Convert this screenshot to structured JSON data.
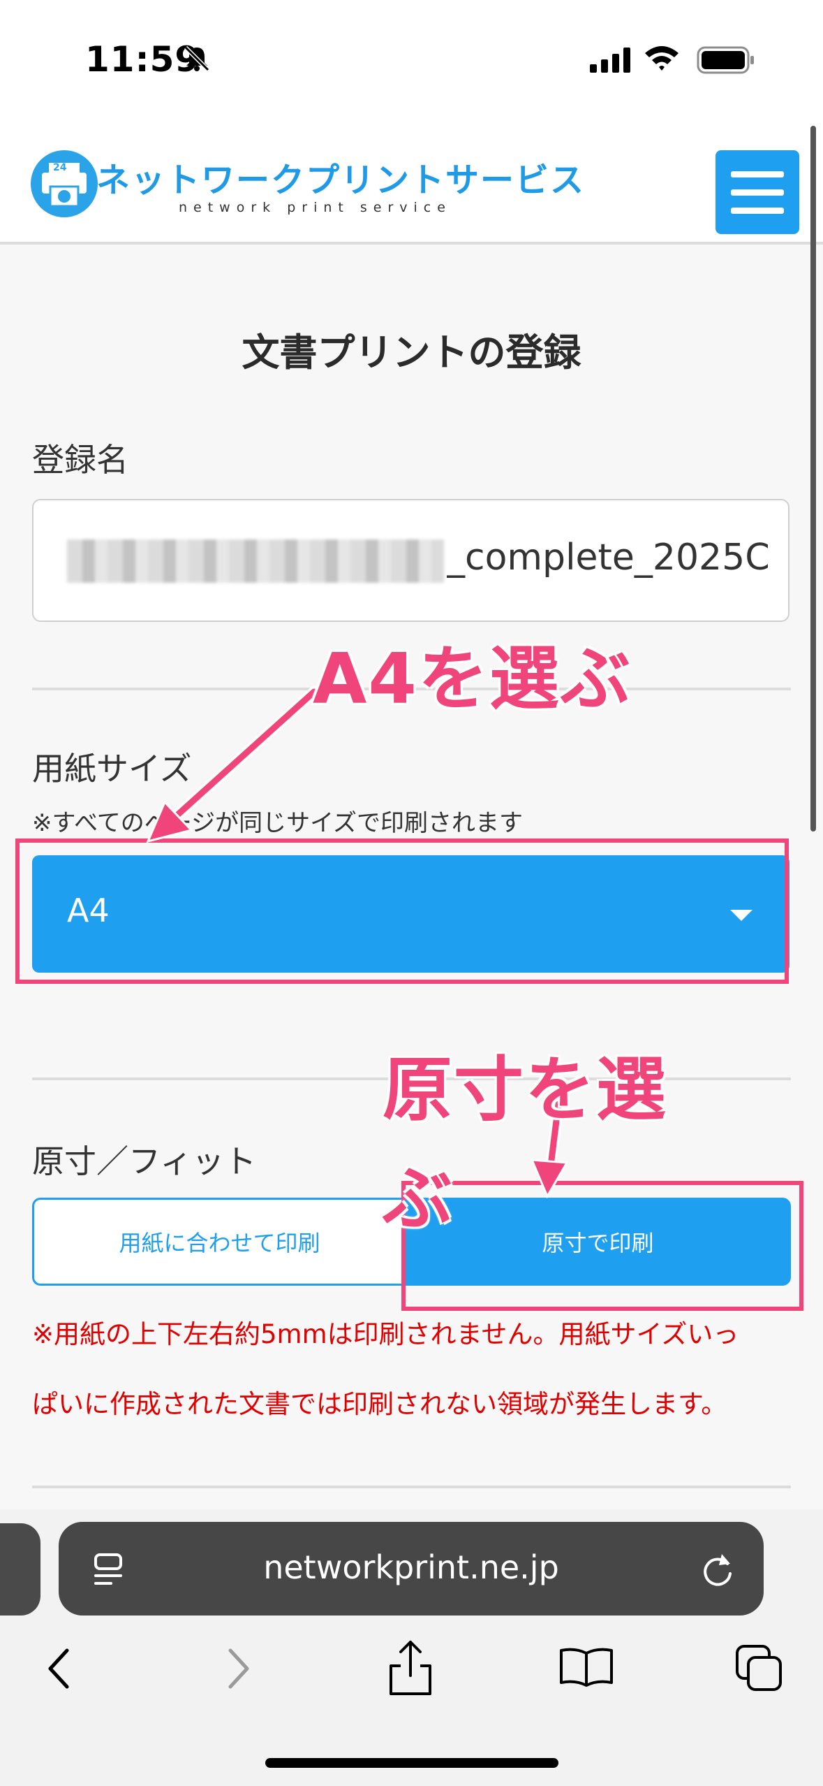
{
  "status_bar": {
    "time": "11:59"
  },
  "header": {
    "logo_title": "ネットワークプリントサービス",
    "logo_subtitle": "network print service",
    "logo_badge": "24",
    "menu_icon": "hamburger-menu-icon"
  },
  "main": {
    "page_title": "文書プリントの登録",
    "registration_name_label": "登録名",
    "registration_name_value": "_complete_2025C",
    "paper_size_label": "用紙サイズ",
    "paper_size_note": "※すべてのページが同じサイズで印刷されます",
    "paper_size_selected": "A4",
    "fit_label": "原寸／フィット",
    "fit_options": [
      "用紙に合わせて印刷",
      "原寸で印刷"
    ],
    "fit_selected": "原寸で印刷",
    "warning_line1": "※用紙の上下左右約5mmは印刷されません。用紙サイズいっ",
    "warning_line2": "ぱいに作成された文書では印刷されない領域が発生します。"
  },
  "annotations": {
    "a4_callout": "A4を選ぶ",
    "original_callout_line1": "原寸を選",
    "original_callout_line2": "ぶ"
  },
  "browser": {
    "url": "networkprint.ne.jp"
  },
  "colors": {
    "accent": "#1e9ff0",
    "annotation": "#f0457a",
    "warning": "#e00000"
  }
}
